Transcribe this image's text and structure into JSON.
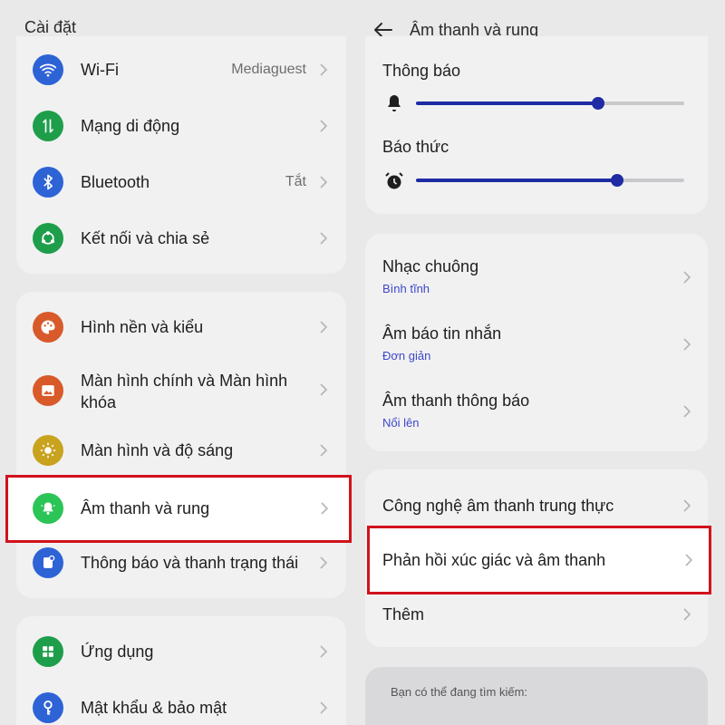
{
  "left": {
    "title": "Cài đặt",
    "group1": [
      {
        "label": "Wi-Fi",
        "value": "Mediaguest",
        "icon": "wifi-icon",
        "color": "#2e63d6"
      },
      {
        "label": "Mạng di động",
        "value": "",
        "icon": "mobile-data-icon",
        "color": "#1e9e4a"
      },
      {
        "label": "Bluetooth",
        "value": "Tắt",
        "icon": "bluetooth-icon",
        "color": "#2e63d6"
      },
      {
        "label": "Kết nối và chia sẻ",
        "value": "",
        "icon": "share-icon",
        "color": "#1e9e4a"
      }
    ],
    "group2": [
      {
        "label": "Hình nền và kiểu",
        "icon": "palette-icon",
        "color": "#d85a2a"
      },
      {
        "label_line1": "Màn hình chính và Màn hình",
        "label_line2": "khóa",
        "icon": "image-icon",
        "color": "#d85a2a"
      },
      {
        "label": "Màn hình và độ sáng",
        "icon": "brightness-icon",
        "color": "#c9a21e"
      },
      {
        "label": "Âm thanh và rung",
        "icon": "bell-icon",
        "color": "#2bc456"
      },
      {
        "label": "Thông báo và thanh trạng thái",
        "icon": "notification-icon",
        "color": "#2e63d6"
      }
    ],
    "group3": [
      {
        "label": "Ứng dụng",
        "icon": "apps-icon",
        "color": "#1e9e4a"
      },
      {
        "label": "Mật khẩu & bảo mật",
        "icon": "key-icon",
        "color": "#2e63d6"
      }
    ]
  },
  "right": {
    "title": "Âm thanh và rung",
    "sliders": [
      {
        "label": "Thông báo",
        "icon": "bell-icon",
        "level_percent": 68
      },
      {
        "label": "Báo thức",
        "icon": "alarm-icon",
        "level_percent": 75
      }
    ],
    "sound_items": [
      {
        "label": "Nhạc chuông",
        "sub": "Bình tĩnh"
      },
      {
        "label": "Âm báo tin nhắn",
        "sub": "Đơn giản"
      },
      {
        "label": "Âm thanh thông báo",
        "sub": "Nổi lên"
      }
    ],
    "more_items": [
      {
        "label": "Công nghệ âm thanh trung thực"
      },
      {
        "label": "Phản hồi xúc giác và âm thanh"
      },
      {
        "label": "Thêm"
      }
    ],
    "search_hint": "Bạn có thể đang tìm kiếm:"
  },
  "colors": {
    "highlight": "#d1121c",
    "accent": "#1e2ba3",
    "sub_text": "#3e47c8"
  }
}
